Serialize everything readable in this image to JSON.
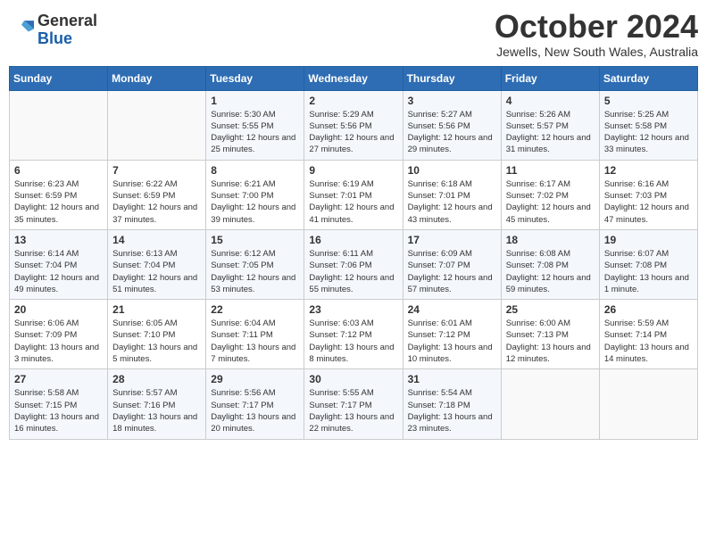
{
  "header": {
    "logo_general": "General",
    "logo_blue": "Blue",
    "month_title": "October 2024",
    "subtitle": "Jewells, New South Wales, Australia"
  },
  "weekdays": [
    "Sunday",
    "Monday",
    "Tuesday",
    "Wednesday",
    "Thursday",
    "Friday",
    "Saturday"
  ],
  "weeks": [
    [
      {
        "day": "",
        "sunrise": "",
        "sunset": "",
        "daylight": ""
      },
      {
        "day": "",
        "sunrise": "",
        "sunset": "",
        "daylight": ""
      },
      {
        "day": "1",
        "sunrise": "Sunrise: 5:30 AM",
        "sunset": "Sunset: 5:55 PM",
        "daylight": "Daylight: 12 hours and 25 minutes."
      },
      {
        "day": "2",
        "sunrise": "Sunrise: 5:29 AM",
        "sunset": "Sunset: 5:56 PM",
        "daylight": "Daylight: 12 hours and 27 minutes."
      },
      {
        "day": "3",
        "sunrise": "Sunrise: 5:27 AM",
        "sunset": "Sunset: 5:56 PM",
        "daylight": "Daylight: 12 hours and 29 minutes."
      },
      {
        "day": "4",
        "sunrise": "Sunrise: 5:26 AM",
        "sunset": "Sunset: 5:57 PM",
        "daylight": "Daylight: 12 hours and 31 minutes."
      },
      {
        "day": "5",
        "sunrise": "Sunrise: 5:25 AM",
        "sunset": "Sunset: 5:58 PM",
        "daylight": "Daylight: 12 hours and 33 minutes."
      }
    ],
    [
      {
        "day": "6",
        "sunrise": "Sunrise: 6:23 AM",
        "sunset": "Sunset: 6:59 PM",
        "daylight": "Daylight: 12 hours and 35 minutes."
      },
      {
        "day": "7",
        "sunrise": "Sunrise: 6:22 AM",
        "sunset": "Sunset: 6:59 PM",
        "daylight": "Daylight: 12 hours and 37 minutes."
      },
      {
        "day": "8",
        "sunrise": "Sunrise: 6:21 AM",
        "sunset": "Sunset: 7:00 PM",
        "daylight": "Daylight: 12 hours and 39 minutes."
      },
      {
        "day": "9",
        "sunrise": "Sunrise: 6:19 AM",
        "sunset": "Sunset: 7:01 PM",
        "daylight": "Daylight: 12 hours and 41 minutes."
      },
      {
        "day": "10",
        "sunrise": "Sunrise: 6:18 AM",
        "sunset": "Sunset: 7:01 PM",
        "daylight": "Daylight: 12 hours and 43 minutes."
      },
      {
        "day": "11",
        "sunrise": "Sunrise: 6:17 AM",
        "sunset": "Sunset: 7:02 PM",
        "daylight": "Daylight: 12 hours and 45 minutes."
      },
      {
        "day": "12",
        "sunrise": "Sunrise: 6:16 AM",
        "sunset": "Sunset: 7:03 PM",
        "daylight": "Daylight: 12 hours and 47 minutes."
      }
    ],
    [
      {
        "day": "13",
        "sunrise": "Sunrise: 6:14 AM",
        "sunset": "Sunset: 7:04 PM",
        "daylight": "Daylight: 12 hours and 49 minutes."
      },
      {
        "day": "14",
        "sunrise": "Sunrise: 6:13 AM",
        "sunset": "Sunset: 7:04 PM",
        "daylight": "Daylight: 12 hours and 51 minutes."
      },
      {
        "day": "15",
        "sunrise": "Sunrise: 6:12 AM",
        "sunset": "Sunset: 7:05 PM",
        "daylight": "Daylight: 12 hours and 53 minutes."
      },
      {
        "day": "16",
        "sunrise": "Sunrise: 6:11 AM",
        "sunset": "Sunset: 7:06 PM",
        "daylight": "Daylight: 12 hours and 55 minutes."
      },
      {
        "day": "17",
        "sunrise": "Sunrise: 6:09 AM",
        "sunset": "Sunset: 7:07 PM",
        "daylight": "Daylight: 12 hours and 57 minutes."
      },
      {
        "day": "18",
        "sunrise": "Sunrise: 6:08 AM",
        "sunset": "Sunset: 7:08 PM",
        "daylight": "Daylight: 12 hours and 59 minutes."
      },
      {
        "day": "19",
        "sunrise": "Sunrise: 6:07 AM",
        "sunset": "Sunset: 7:08 PM",
        "daylight": "Daylight: 13 hours and 1 minute."
      }
    ],
    [
      {
        "day": "20",
        "sunrise": "Sunrise: 6:06 AM",
        "sunset": "Sunset: 7:09 PM",
        "daylight": "Daylight: 13 hours and 3 minutes."
      },
      {
        "day": "21",
        "sunrise": "Sunrise: 6:05 AM",
        "sunset": "Sunset: 7:10 PM",
        "daylight": "Daylight: 13 hours and 5 minutes."
      },
      {
        "day": "22",
        "sunrise": "Sunrise: 6:04 AM",
        "sunset": "Sunset: 7:11 PM",
        "daylight": "Daylight: 13 hours and 7 minutes."
      },
      {
        "day": "23",
        "sunrise": "Sunrise: 6:03 AM",
        "sunset": "Sunset: 7:12 PM",
        "daylight": "Daylight: 13 hours and 8 minutes."
      },
      {
        "day": "24",
        "sunrise": "Sunrise: 6:01 AM",
        "sunset": "Sunset: 7:12 PM",
        "daylight": "Daylight: 13 hours and 10 minutes."
      },
      {
        "day": "25",
        "sunrise": "Sunrise: 6:00 AM",
        "sunset": "Sunset: 7:13 PM",
        "daylight": "Daylight: 13 hours and 12 minutes."
      },
      {
        "day": "26",
        "sunrise": "Sunrise: 5:59 AM",
        "sunset": "Sunset: 7:14 PM",
        "daylight": "Daylight: 13 hours and 14 minutes."
      }
    ],
    [
      {
        "day": "27",
        "sunrise": "Sunrise: 5:58 AM",
        "sunset": "Sunset: 7:15 PM",
        "daylight": "Daylight: 13 hours and 16 minutes."
      },
      {
        "day": "28",
        "sunrise": "Sunrise: 5:57 AM",
        "sunset": "Sunset: 7:16 PM",
        "daylight": "Daylight: 13 hours and 18 minutes."
      },
      {
        "day": "29",
        "sunrise": "Sunrise: 5:56 AM",
        "sunset": "Sunset: 7:17 PM",
        "daylight": "Daylight: 13 hours and 20 minutes."
      },
      {
        "day": "30",
        "sunrise": "Sunrise: 5:55 AM",
        "sunset": "Sunset: 7:17 PM",
        "daylight": "Daylight: 13 hours and 22 minutes."
      },
      {
        "day": "31",
        "sunrise": "Sunrise: 5:54 AM",
        "sunset": "Sunset: 7:18 PM",
        "daylight": "Daylight: 13 hours and 23 minutes."
      },
      {
        "day": "",
        "sunrise": "",
        "sunset": "",
        "daylight": ""
      },
      {
        "day": "",
        "sunrise": "",
        "sunset": "",
        "daylight": ""
      }
    ]
  ]
}
